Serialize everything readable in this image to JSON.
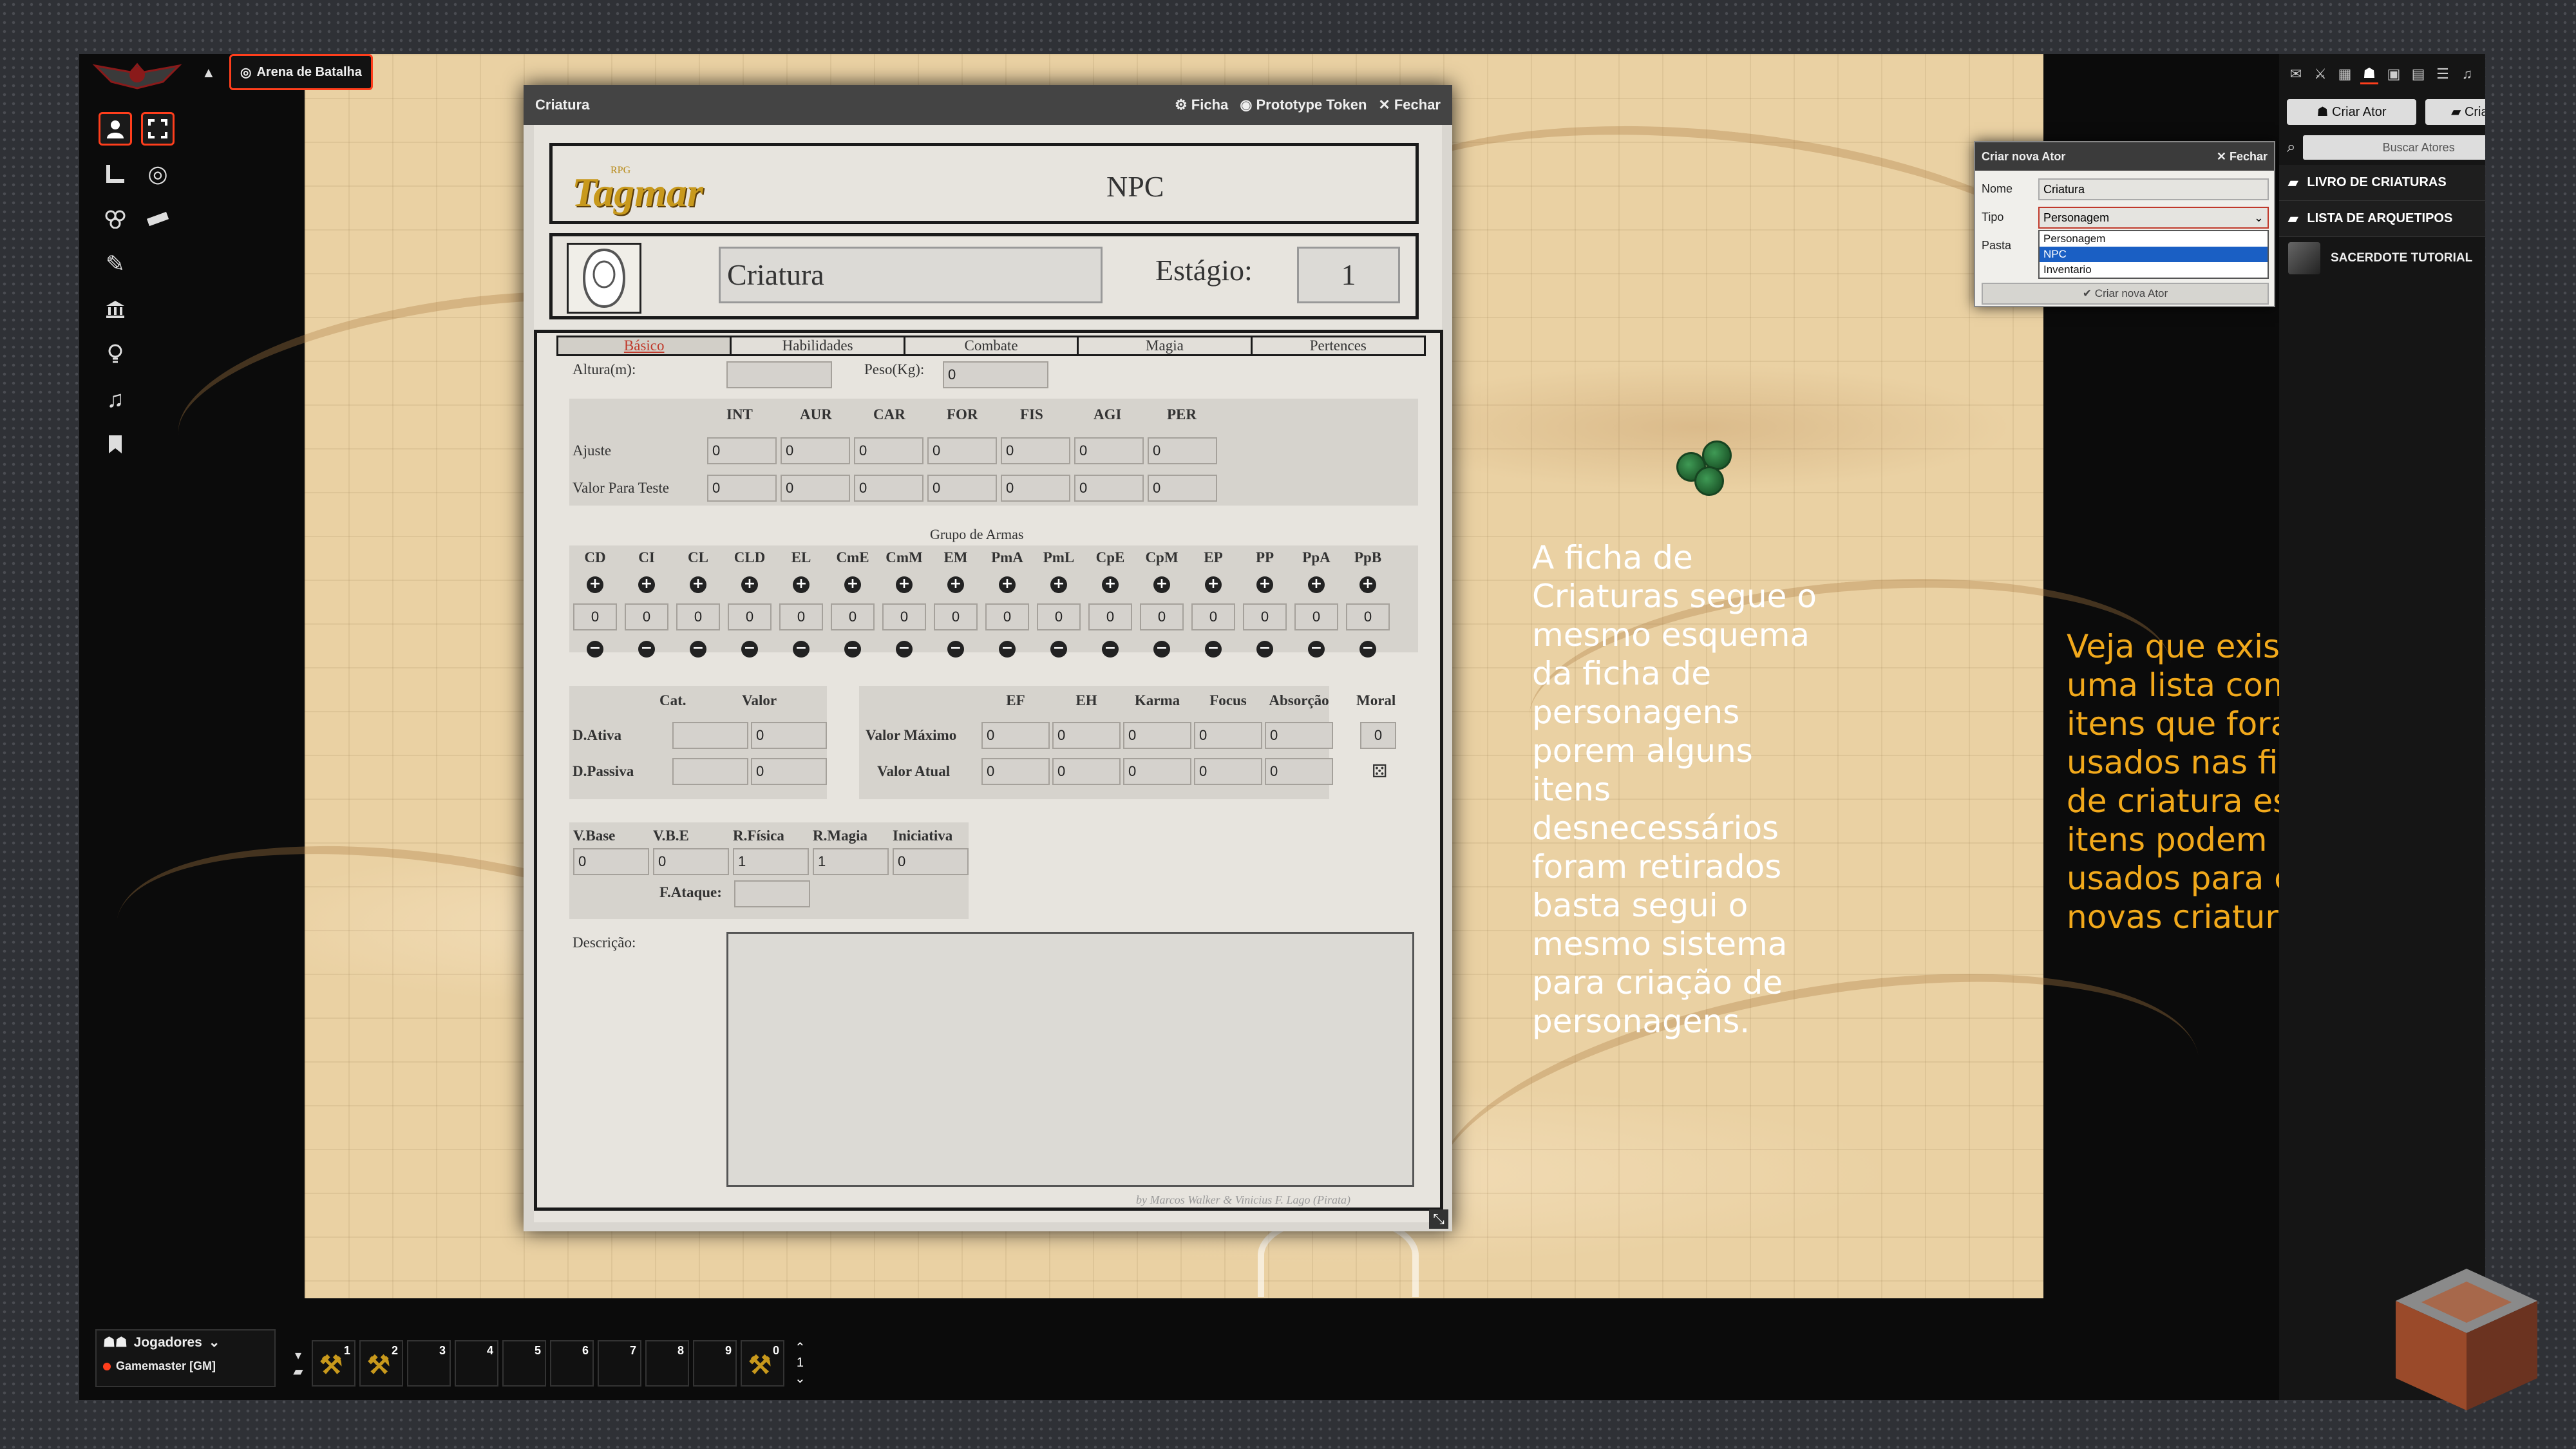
{
  "scene": {
    "tab_label": "Arena de Batalha"
  },
  "sheet": {
    "window_title": "Criatura",
    "header_buttons": [
      "Ficha",
      "Prototype Token",
      "Fechar"
    ],
    "brand_small": "RPG",
    "brand_name": "Tagmar",
    "sheet_type": "NPC",
    "name": "Criatura",
    "stage_label": "Estágio:",
    "stage_value": "1",
    "tabs": [
      "Básico",
      "Habilidades",
      "Combate",
      "Magia",
      "Pertences"
    ],
    "height_label": "Altura(m):",
    "weight_label": "Peso(Kg):",
    "weight_value": "0",
    "attr_headers": [
      "INT",
      "AUR",
      "CAR",
      "FOR",
      "FIS",
      "AGI",
      "PER"
    ],
    "row_adjust_label": "Ajuste",
    "row_test_label": "Valor Para Teste",
    "adjust_values": [
      "0",
      "0",
      "0",
      "0",
      "0",
      "0",
      "0"
    ],
    "test_values": [
      "0",
      "0",
      "0",
      "0",
      "0",
      "0",
      "0"
    ],
    "weapons_title": "Grupo de Armas",
    "weapon_groups": [
      "CD",
      "CI",
      "CL",
      "CLD",
      "EL",
      "CmE",
      "CmM",
      "EM",
      "PmA",
      "PmL",
      "CpE",
      "CpM",
      "EP",
      "PP",
      "PpA",
      "PpB"
    ],
    "weapon_values": [
      "0",
      "0",
      "0",
      "0",
      "0",
      "0",
      "0",
      "0",
      "0",
      "0",
      "0",
      "0",
      "0",
      "0",
      "0",
      "0"
    ],
    "defense_headers": [
      "Cat.",
      "Valor"
    ],
    "defense_active_label": "D.Ativa",
    "defense_active_value": "0",
    "defense_passive_label": "D.Passiva",
    "defense_passive_value": "0",
    "energy_headers": [
      "EF",
      "EH",
      "Karma",
      "Focus",
      "Absorção"
    ],
    "max_label": "Valor Máximo",
    "max_values": [
      "0",
      "0",
      "0",
      "0",
      "0"
    ],
    "current_label": "Valor Atual",
    "current_values": [
      "0",
      "0",
      "0",
      "0",
      "0"
    ],
    "moral_label": "Moral",
    "moral_value": "0",
    "speed_headers": [
      "V.Base",
      "V.B.E",
      "R.Física",
      "R.Magia",
      "Iniciativa"
    ],
    "speed_values": [
      "0",
      "0",
      "1",
      "1",
      "0"
    ],
    "attack_label": "F.Ataque:",
    "description_label": "Descrição:",
    "credit": "by Marcos Walker & Vinicius F. Lago (Pirata)"
  },
  "annotations": {
    "white": "A ficha de Criaturas segue o mesmo esquema da ficha de personagens porem alguns itens desnecessários foram retirados basta segui o mesmo sistema para criação de personagens.",
    "yellow": "Veja que existe uma lista com itens que foram usados nas fichas de criatura esses itens podem ser usados para criar novas criaturas."
  },
  "dialog": {
    "title": "Criar nova Ator",
    "close_label": "Fechar",
    "name_label": "Nome",
    "name_value": "Criatura",
    "type_label": "Tipo",
    "type_selected": "Personagem",
    "type_options": [
      "Personagem",
      "NPC",
      "Inventario"
    ],
    "highlighted_option": "NPC",
    "folder_label": "Pasta",
    "submit_label": "Criar nova Ator"
  },
  "sidebar": {
    "create_actor": "Criar Ator",
    "create_folder": "Criar Pasta",
    "search_placeholder": "Buscar Atores",
    "folders": [
      "LIVRO DE CRIATURAS",
      "LISTA DE ARQUETIPOS"
    ],
    "actors": [
      "SACERDOTE TUTORIAL"
    ]
  },
  "players": {
    "title": "Jogadores",
    "gm": "Gamemaster [GM]"
  },
  "hotbar": {
    "slots": [
      "1",
      "2",
      "3",
      "4",
      "5",
      "6",
      "7",
      "8",
      "9",
      "0"
    ],
    "macro_slots": [
      0,
      1,
      9
    ],
    "page": "1"
  },
  "colors": {
    "accent": "#ff3e1c",
    "annotation_yellow": "#f2a91b",
    "sand": "#ead1a3"
  }
}
